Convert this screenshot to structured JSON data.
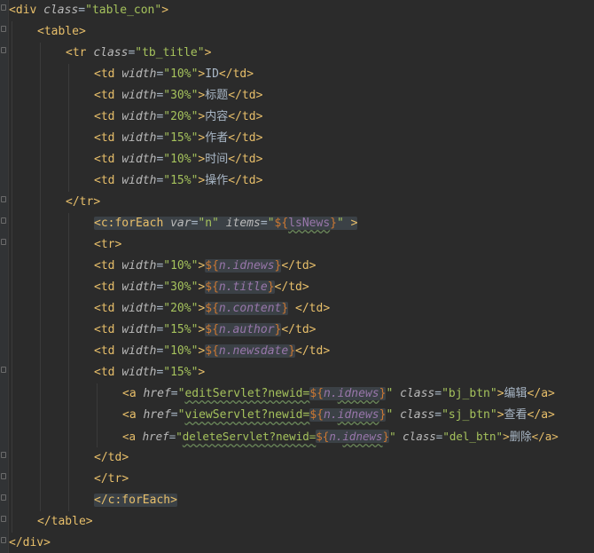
{
  "tokens": {
    "lt": "<",
    "gt": ">",
    "lts": "</",
    "eq": "=",
    "q": "\"",
    "div": "div",
    "class": "class",
    "table_con": "table_con",
    "table": "table",
    "tr": "tr",
    "tb_title": "tb_title",
    "td": "td",
    "width": "width",
    "w10": "10%",
    "w30": "30%",
    "w20": "20%",
    "w15": "15%",
    "t_id": "ID",
    "t_title": "标题",
    "t_content": "内容",
    "t_author": "作者",
    "t_time": "时间",
    "t_op": "操作",
    "c_foreach": "c:forEach",
    "var": "var",
    "n": "n",
    "items": "items",
    "ds_open": "${",
    "close_brace": "}",
    "lsNews": "lsNews",
    "n_idnews": "n.idnews",
    "n_title": "n.title",
    "n_content": "n.content",
    "n_author": "n.author",
    "n_newsdate": "n.newsdate",
    "a": "a",
    "href": "href",
    "editServlet": "editServlet?newid=",
    "viewServlet": "viewServlet?newid=",
    "deleteServlet": "deleteServlet?newid=",
    "n_dot": "n.",
    "idnews": "idnews",
    "bj_btn": "bj_btn",
    "sj_btn": "sj_btn",
    "del_btn": "del_btn",
    "edit_txt": "编辑",
    "view_txt": "查看",
    "delete_txt": "删除"
  },
  "colors": {
    "background": "#2b2b2b",
    "tag": "#e8bf6a",
    "attribute_name": "#bababa",
    "attribute_value": "#a5c25c",
    "text": "#a9b7c6",
    "el_expression": "#cc7832",
    "el_variable": "#9876aa"
  }
}
